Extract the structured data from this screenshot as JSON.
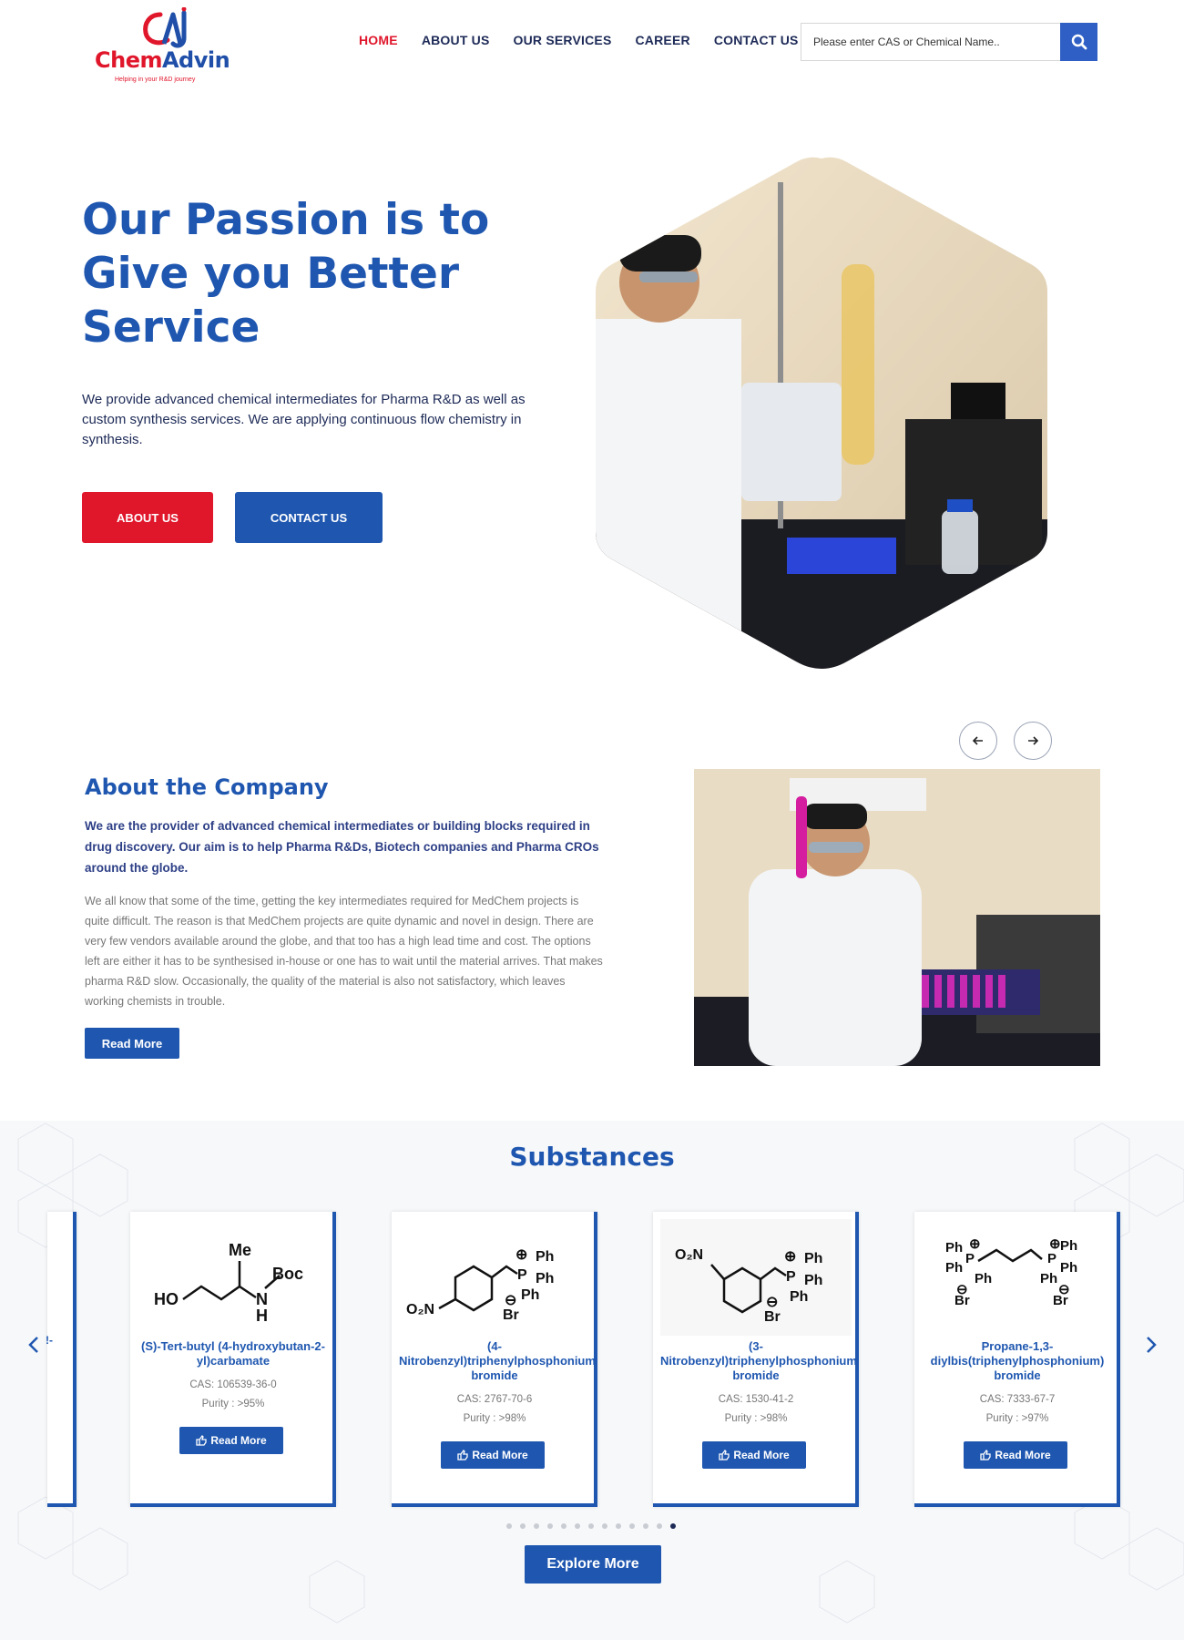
{
  "brand": {
    "name_part1": "Chem",
    "name_part2": "Advin",
    "tagline": "Helping in your R&D journey",
    "primary_color": "#1f57b0",
    "accent_color": "#e0162b"
  },
  "nav": {
    "items": [
      "HOME",
      "ABOUT US",
      "OUR SERVICES",
      "CAREER",
      "CONTACT US"
    ],
    "active": "HOME"
  },
  "search": {
    "placeholder": "Please enter CAS or Chemical Name..",
    "icon": "search-icon"
  },
  "hero": {
    "title": "Our Passion is to Give you Better Service",
    "text": "We provide advanced chemical intermediates for Pharma R&D as well as custom synthesis services. We are applying continuous flow chemistry in synthesis.",
    "btn_about": "ABOUT US",
    "btn_contact": "CONTACT US"
  },
  "about": {
    "title": "About the Company",
    "lead": "We are the provider of advanced chemical intermediates or building blocks required in drug discovery. Our aim is to help Pharma R&Ds, Biotech companies and Pharma CROs around the globe.",
    "body": "We all know that some of the time, getting the key intermediates required for MedChem projects is quite difficult. The reason is that MedChem projects are quite dynamic and novel in design. There are very few vendors available around the globe, and that too has a high lead time and cost. The options left are either it has to be synthesised in-house or one has to wait until the material arrives. That makes pharma R&D slow. Occasionally, the quality of the material is also not satisfactory, which leaves working chemists in trouble.",
    "read_more": "Read More"
  },
  "substances": {
    "title": "Substances",
    "cards": [
      {
        "name": "(S)-Tert-butyl (4-hydroxybutan-2-yl)carbamate",
        "cas": "CAS: 106539-36-0",
        "purity": "Purity : >95%",
        "button": "Read More"
      },
      {
        "name": "(4-Nitrobenzyl)triphenylphosphonium bromide",
        "cas": "CAS: 2767-70-6",
        "purity": "Purity : >98%",
        "button": "Read More"
      },
      {
        "name": "(3-Nitrobenzyl)triphenylphosphonium bromide",
        "cas": "CAS: 1530-41-2",
        "purity": "Purity : >98%",
        "button": "Read More"
      },
      {
        "name": "Propane-1,3-diylbis(triphenylphosphonium) bromide",
        "cas": "CAS: 7333-67-7",
        "purity": "Purity : >97%",
        "button": "Read More"
      }
    ],
    "explore": "Explore More",
    "dot_count": 13,
    "active_dot": 12,
    "partial_text": "!-"
  }
}
